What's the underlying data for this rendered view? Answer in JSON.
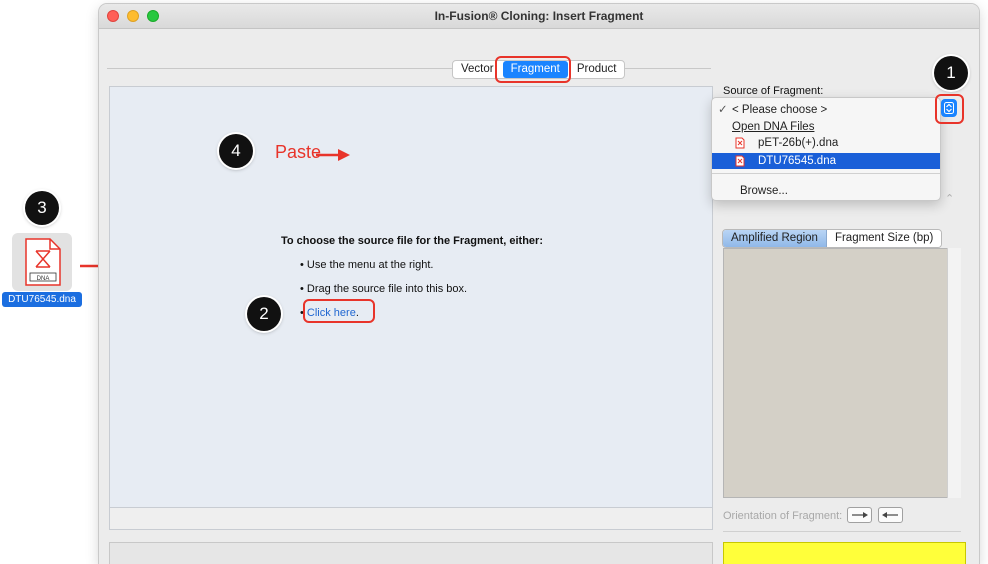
{
  "window": {
    "title": "In-Fusion® Cloning: Insert Fragment"
  },
  "tabs": [
    {
      "label": "Vector",
      "active": false
    },
    {
      "label": "Fragment",
      "active": true
    },
    {
      "label": "Product",
      "active": false
    }
  ],
  "drop_zone": {
    "heading": "To choose the source file for the Fragment, either:",
    "bullets": [
      "• Use the menu at the right.",
      "• Drag the source file into this box."
    ],
    "click_bullet": "•",
    "click_link": "Click here",
    "click_period": "."
  },
  "annotations": {
    "step1": "1",
    "step2": "2",
    "step3": "3",
    "step4": "4",
    "paste_label": "Paste"
  },
  "source": {
    "label": "Source of Fragment:",
    "menu_items": [
      {
        "label": "< Please choose >",
        "checked": true,
        "checkmark": "✓"
      },
      {
        "label": "Open DNA Files",
        "underlined": true
      },
      {
        "label": "pET-26b(+).dna",
        "icon": "dna-file-icon"
      },
      {
        "label": "DTU76545.dna",
        "icon": "dna-file-icon",
        "selected": true
      },
      {
        "label": "Browse..."
      }
    ]
  },
  "region_tabs": [
    {
      "label": "Amplified Region",
      "active": true
    },
    {
      "label": "Fragment Size (bp)",
      "active": false
    }
  ],
  "orientation": {
    "label": "Orientation of Fragment:"
  },
  "desktop_file": {
    "name": "DTU76545.dna",
    "badge_text": "DNA"
  },
  "colors": {
    "accent_blue": "#1a84ff",
    "annotation_red": "#e8342a",
    "menu_select": "#1a5fd8",
    "warning_yellow": "#ffff3a"
  }
}
